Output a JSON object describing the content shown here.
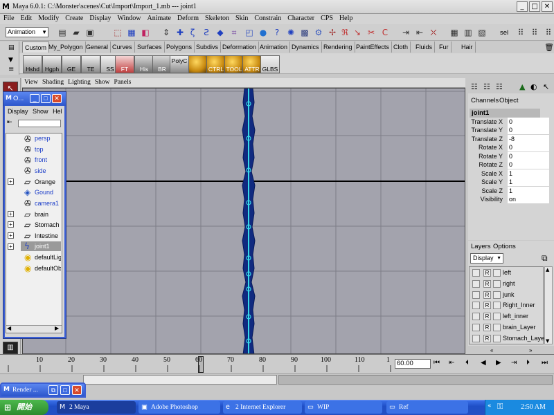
{
  "window": {
    "title": "Maya 6.0.1: C:\\Monster\\scenes\\Cut\\Import\\Import_1.mb   ---   joint1",
    "min": "_",
    "max": "□",
    "close": "✕"
  },
  "menubar": [
    "File",
    "Edit",
    "Modify",
    "Create",
    "Display",
    "Window",
    "Animate",
    "Deform",
    "Skeleton",
    "Skin",
    "Constrain",
    "Character",
    "CPS",
    "Help"
  ],
  "toolbar": {
    "mode": "Animation",
    "sel_label": "sel"
  },
  "shelf": {
    "tabs": [
      "Custom",
      "My_Polygon",
      "General",
      "Curves",
      "Surfaces",
      "Polygons",
      "Subdivs",
      "Deformation",
      "Animation",
      "Dynamics",
      "Rendering",
      "PaintEffects",
      "Cloth",
      "Fluids",
      "Fur",
      "Hair"
    ],
    "buttons": [
      "Hshd",
      "Hgph",
      "GE",
      "TE",
      "SS",
      "FT",
      "His",
      "BR",
      "PolyC",
      "",
      "CTRL",
      "TOOL",
      "ATTR",
      "GLBS"
    ]
  },
  "viewport": {
    "menu": [
      "View",
      "Shading",
      "Lighting",
      "Show",
      "Panels"
    ]
  },
  "outliner": {
    "title": "O...",
    "menu": [
      "Display",
      "Show",
      "Help"
    ],
    "items": [
      {
        "label": "persp",
        "icon": "camera-icon"
      },
      {
        "label": "top",
        "icon": "camera-icon"
      },
      {
        "label": "front",
        "icon": "camera-icon"
      },
      {
        "label": "side",
        "icon": "camera-icon"
      },
      {
        "label": "Orange",
        "icon": "curve-icon"
      },
      {
        "label": "Gound",
        "icon": "plane-icon"
      },
      {
        "label": "camera1",
        "icon": "camera-icon"
      },
      {
        "label": "brain",
        "icon": "curve-icon"
      },
      {
        "label": "Stomach",
        "icon": "curve-icon"
      },
      {
        "label": "Intestine",
        "icon": "curve-icon"
      },
      {
        "label": "joint1",
        "icon": "joint-icon"
      },
      {
        "label": "defaultLightSet",
        "icon": "set-icon"
      },
      {
        "label": "defaultObjectSet",
        "icon": "set-icon"
      }
    ]
  },
  "channel_box": {
    "tabs": [
      "Channels",
      "Object"
    ],
    "node": "joint1",
    "rows": [
      {
        "label": "Translate X",
        "value": "0"
      },
      {
        "label": "Translate Y",
        "value": "0"
      },
      {
        "label": "Translate Z",
        "value": "-8"
      },
      {
        "label": "Rotate X",
        "value": "0"
      },
      {
        "label": "Rotate Y",
        "value": "0"
      },
      {
        "label": "Rotate Z",
        "value": "0"
      },
      {
        "label": "Scale X",
        "value": "1"
      },
      {
        "label": "Scale Y",
        "value": "1"
      },
      {
        "label": "Scale Z",
        "value": "1"
      },
      {
        "label": "Visibility",
        "value": "on"
      }
    ]
  },
  "layers": {
    "tabs": [
      "Layers",
      "Options"
    ],
    "mode": "Display",
    "items": [
      "left",
      "right",
      "junk",
      "Right_Inner",
      "left_inner",
      "brain_Layer",
      "Stomach_Layer"
    ]
  },
  "timeline": {
    "ticks": [
      "10",
      "20",
      "30",
      "40",
      "50",
      "60",
      "70",
      "80",
      "90",
      "100",
      "110",
      "1"
    ],
    "current_frame": "60.00"
  },
  "render_window": {
    "title": "Render ..."
  },
  "taskbar": {
    "start": "開始",
    "tasks": [
      "2 Maya",
      "Adobe Photoshop",
      "2 Internet Explorer",
      "WIP",
      "Ref"
    ],
    "clock": "2:50 AM"
  }
}
